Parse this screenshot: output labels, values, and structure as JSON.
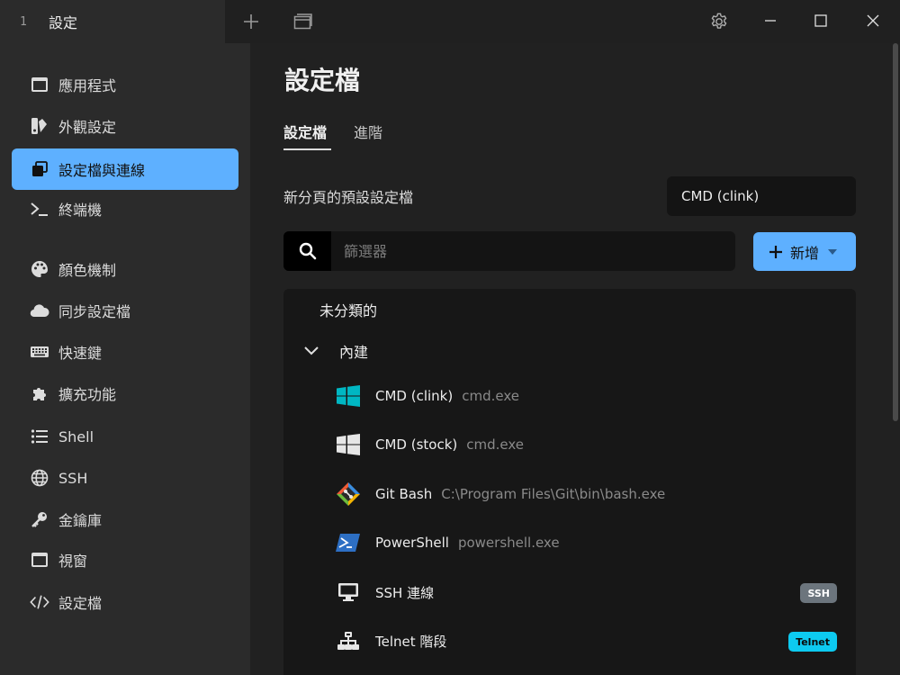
{
  "titlebar": {
    "tab_number": "1",
    "tab_title": "設定",
    "icons": [
      "plus-icon",
      "new-window-icon",
      "gear-icon",
      "minimize-icon",
      "maximize-icon",
      "close-icon"
    ]
  },
  "sidebar": {
    "items": [
      {
        "label": "應用程式",
        "icon": "app-window-icon"
      },
      {
        "label": "外觀設定",
        "icon": "palette-swatch-icon"
      },
      {
        "label": "設定檔與連線",
        "icon": "windows-stack-icon",
        "active": true
      },
      {
        "label": "終端機",
        "icon": "terminal-prompt-icon"
      },
      {
        "label": "顏色機制",
        "icon": "palette-icon"
      },
      {
        "label": "同步設定檔",
        "icon": "cloud-icon"
      },
      {
        "label": "快速鍵",
        "icon": "keyboard-icon"
      },
      {
        "label": "擴充功能",
        "icon": "puzzle-icon"
      },
      {
        "label": "Shell",
        "icon": "list-icon"
      },
      {
        "label": "SSH",
        "icon": "globe-icon"
      },
      {
        "label": "金鑰庫",
        "icon": "key-icon"
      },
      {
        "label": "視窗",
        "icon": "window-icon"
      },
      {
        "label": "設定檔",
        "icon": "code-icon"
      }
    ]
  },
  "main": {
    "title": "設定檔",
    "tabs": [
      {
        "label": "設定檔",
        "active": true
      },
      {
        "label": "進階",
        "active": false
      }
    ],
    "default_profile": {
      "label": "新分頁的預設設定檔",
      "value": "CMD (clink)"
    },
    "filter": {
      "placeholder": "篩選器",
      "value": ""
    },
    "add_button": {
      "label": "新增"
    },
    "groups": {
      "uncategorized": "未分類的",
      "builtin": "內建"
    },
    "profiles": [
      {
        "name": "CMD (clink)",
        "command": "cmd.exe",
        "icon": "windows-logo-icon",
        "icon_color": "#00b7c3"
      },
      {
        "name": "CMD (stock)",
        "command": "cmd.exe",
        "icon": "windows-logo-icon",
        "icon_color": "#e6e6e6"
      },
      {
        "name": "Git Bash",
        "command": "C:\\Program Files\\Git\\bin\\bash.exe",
        "icon": "git-bash-icon"
      },
      {
        "name": "PowerShell",
        "command": "powershell.exe",
        "icon": "powershell-icon"
      },
      {
        "name": "SSH 連線",
        "command": "",
        "icon": "monitor-icon",
        "badge": "SSH",
        "badge_color": "#6c757d"
      },
      {
        "name": "Telnet 階段",
        "command": "",
        "icon": "network-icon",
        "badge": "Telnet",
        "badge_color": "#0dcaf0"
      }
    ]
  },
  "colors": {
    "accent": "#5eb0ff",
    "background": "#212121",
    "sidebar": "#2b2b2b"
  }
}
